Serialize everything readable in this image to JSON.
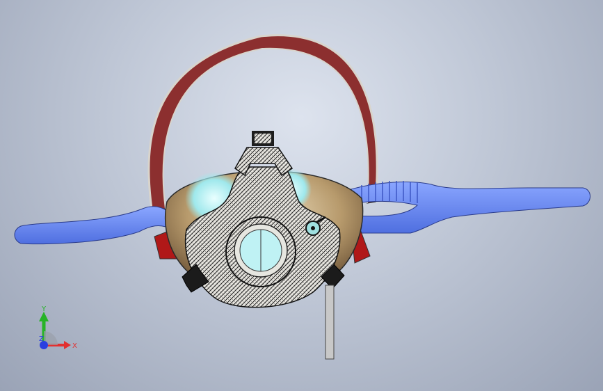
{
  "viewport": {
    "background_top": "#dde3ee",
    "background_bottom": "#9aa3b6"
  },
  "model": {
    "colors": {
      "strap": "#8c2f2f",
      "strap_edge": "#d8d4cc",
      "shell": "#b79a6c",
      "tubing": "#6f8df0",
      "lens": "#bff2f4",
      "frame": "#2c2a28",
      "rod": "#c8c8c8"
    }
  },
  "triad": {
    "y_label": "Y",
    "x_label": "X",
    "z_label": "Z",
    "colors": {
      "x": "#e23030",
      "y": "#27b327",
      "z": "#2a3fe0"
    }
  }
}
